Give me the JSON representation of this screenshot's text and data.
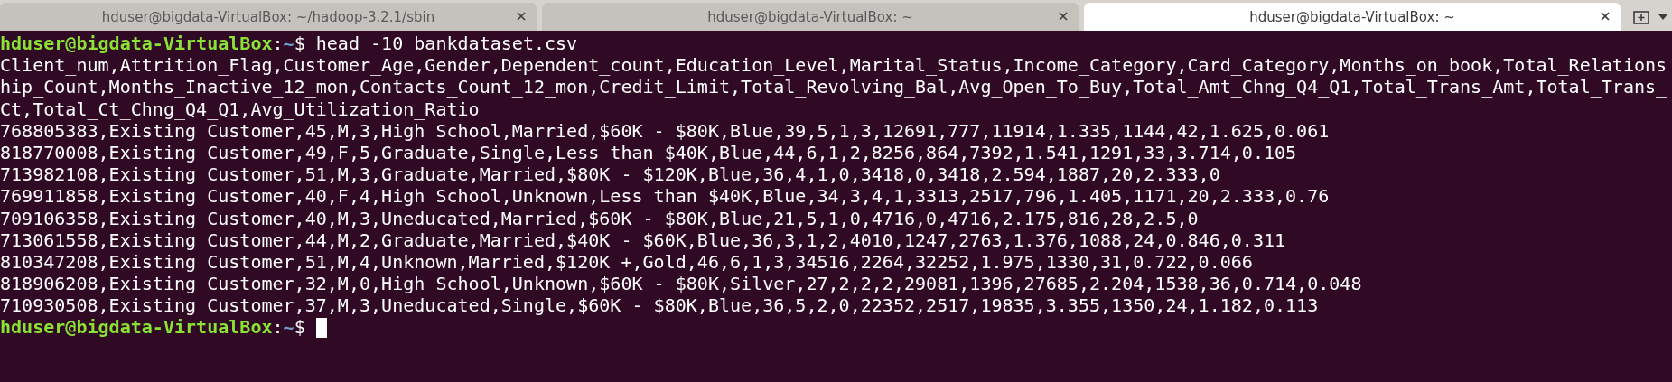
{
  "tabs": [
    {
      "title": "hduser@bigdata-VirtualBox: ~/hadoop-3.2.1/sbin",
      "selected": false
    },
    {
      "title": "hduser@bigdata-VirtualBox: ~",
      "selected": false
    },
    {
      "title": "hduser@bigdata-VirtualBox: ~",
      "selected": true
    }
  ],
  "terminal_lines": [
    {
      "kind": "prompt",
      "user_host": "hduser@bigdata-VirtualBox",
      "separator": ":",
      "path": "~",
      "command": "$ head -10 bankdataset.csv"
    },
    {
      "kind": "output",
      "text": "Client_num,Attrition_Flag,Customer_Age,Gender,Dependent_count,Education_Level,Marital_Status,Income_Category,Card_Category,Months_on_book,Total_Relations"
    },
    {
      "kind": "output",
      "text": "hip_Count,Months_Inactive_12_mon,Contacts_Count_12_mon,Credit_Limit,Total_Revolving_Bal,Avg_Open_To_Buy,Total_Amt_Chng_Q4_Q1,Total_Trans_Amt,Total_Trans_"
    },
    {
      "kind": "output",
      "text": "Ct,Total_Ct_Chng_Q4_Q1,Avg_Utilization_Ratio"
    },
    {
      "kind": "output",
      "text": "768805383,Existing Customer,45,M,3,High School,Married,$60K - $80K,Blue,39,5,1,3,12691,777,11914,1.335,1144,42,1.625,0.061"
    },
    {
      "kind": "output",
      "text": "818770008,Existing Customer,49,F,5,Graduate,Single,Less than $40K,Blue,44,6,1,2,8256,864,7392,1.541,1291,33,3.714,0.105"
    },
    {
      "kind": "output",
      "text": "713982108,Existing Customer,51,M,3,Graduate,Married,$80K - $120K,Blue,36,4,1,0,3418,0,3418,2.594,1887,20,2.333,0"
    },
    {
      "kind": "output",
      "text": "769911858,Existing Customer,40,F,4,High School,Unknown,Less than $40K,Blue,34,3,4,1,3313,2517,796,1.405,1171,20,2.333,0.76"
    },
    {
      "kind": "output",
      "text": "709106358,Existing Customer,40,M,3,Uneducated,Married,$60K - $80K,Blue,21,5,1,0,4716,0,4716,2.175,816,28,2.5,0"
    },
    {
      "kind": "output",
      "text": "713061558,Existing Customer,44,M,2,Graduate,Married,$40K - $60K,Blue,36,3,1,2,4010,1247,2763,1.376,1088,24,0.846,0.311"
    },
    {
      "kind": "output",
      "text": "810347208,Existing Customer,51,M,4,Unknown,Married,$120K +,Gold,46,6,1,3,34516,2264,32252,1.975,1330,31,0.722,0.066"
    },
    {
      "kind": "output",
      "text": "818906208,Existing Customer,32,M,0,High School,Unknown,$60K - $80K,Silver,27,2,2,2,29081,1396,27685,2.204,1538,36,0.714,0.048"
    },
    {
      "kind": "output",
      "text": "710930508,Existing Customer,37,M,3,Uneducated,Single,$60K - $80K,Blue,36,5,2,0,22352,2517,19835,3.355,1350,24,1.182,0.113"
    },
    {
      "kind": "prompt",
      "user_host": "hduser@bigdata-VirtualBox",
      "separator": ":",
      "path": "~",
      "command": "$ ",
      "cursor": true
    }
  ]
}
